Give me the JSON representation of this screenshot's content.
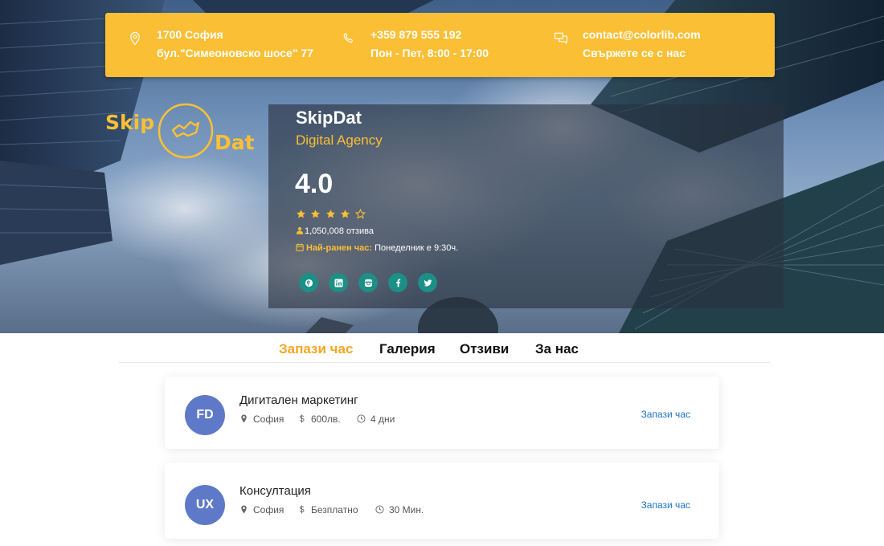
{
  "contact": {
    "address_line1": "1700 София",
    "address_line2": "бул.\"Симеоновско шосе\" 77",
    "phone": "+359 879 555 192",
    "hours": "Пон - Пет, 8:00 - 17:00",
    "email": "contact@colorlib.com",
    "contact_cta": "Свържете се с нас"
  },
  "logo": {
    "left": "Skip",
    "right": "Dat"
  },
  "company": {
    "name": "SkipDat",
    "tagline": "Digital Agency",
    "rating": "4.0",
    "stars_filled": 4,
    "stars_total": 5,
    "reviews": "1,050,008 отзива",
    "earliest_label": "Най-ранен час:",
    "earliest_value": "Понеделник е 9:30ч."
  },
  "socials": [
    "pinterest-icon",
    "linkedin-icon",
    "instagram-icon",
    "facebook-icon",
    "twitter-icon"
  ],
  "tabs": [
    {
      "label": "Запази час",
      "active": true
    },
    {
      "label": "Галерия",
      "active": false
    },
    {
      "label": "Отзиви",
      "active": false
    },
    {
      "label": "За нас",
      "active": false
    }
  ],
  "services": [
    {
      "initials": "FD",
      "title": "Дигитален маркетинг",
      "location": "София",
      "price": "600лв.",
      "duration": "4 дни",
      "action": "Запази час"
    },
    {
      "initials": "UX",
      "title": "Консултация",
      "location": "София",
      "price": "Безплатно",
      "duration": "30 Мин.",
      "action": "Запази час"
    }
  ],
  "colors": {
    "accent": "#fbbf35",
    "tab_active": "#f5a623",
    "avatar": "#5f79c9",
    "social": "#1c8f86",
    "link": "#1a73c7"
  }
}
